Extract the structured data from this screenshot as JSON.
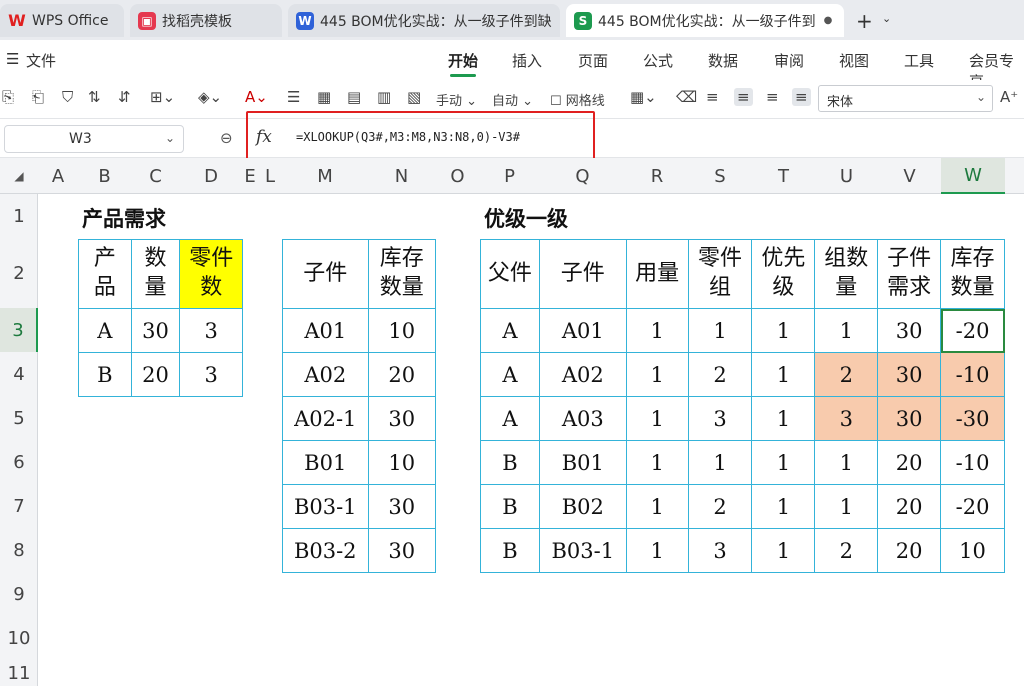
{
  "tabs": [
    {
      "label": "WPS Office",
      "icon": "wps-logo-icon",
      "color": "#e02020"
    },
    {
      "label": "找稻壳模板",
      "icon": "docer-icon",
      "color": "#e5384f"
    },
    {
      "label": "445 BOM优化实战：从一级子件到缺",
      "icon": "W",
      "color": "#2f62d8"
    },
    {
      "label": "445 BOM优化实战：从一级子件到",
      "icon": "S",
      "color": "#1d9a4f"
    }
  ],
  "new_tab_label": "+",
  "file_menu": "文件",
  "menus": [
    "开始",
    "插入",
    "页面",
    "公式",
    "数据",
    "审阅",
    "视图",
    "工具",
    "会员专享"
  ],
  "toolbar": {
    "manual_label": "手动",
    "auto_label": "自动",
    "gridlines_label": "网格线",
    "font_name": "宋体"
  },
  "name_box": "W3",
  "formula": "=XLOOKUP(Q3#,M3:M8,N3:N8,0)-V3#",
  "columns": [
    "A",
    "B",
    "C",
    "D",
    "E",
    "L",
    "M",
    "N",
    "O",
    "P",
    "Q",
    "R",
    "S",
    "T",
    "U",
    "V",
    "W"
  ],
  "rows": [
    "1",
    "2",
    "3",
    "4",
    "5",
    "6",
    "7",
    "8",
    "9",
    "10",
    "11"
  ],
  "table1": {
    "title": "产品需求",
    "headers": [
      "产\n品",
      "数\n量",
      "零件\n数"
    ],
    "rows": [
      [
        "A",
        "30",
        "3"
      ],
      [
        "B",
        "20",
        "3"
      ]
    ]
  },
  "table2": {
    "headers": [
      "子件",
      "库存\n数量"
    ],
    "rows": [
      [
        "A01",
        "10"
      ],
      [
        "A02",
        "20"
      ],
      [
        "A02-1",
        "30"
      ],
      [
        "B01",
        "10"
      ],
      [
        "B03-1",
        "30"
      ],
      [
        "B03-2",
        "30"
      ]
    ]
  },
  "table3": {
    "title": "优级一级",
    "headers": [
      "父件",
      "子件",
      "用量",
      "零件\n组",
      "优先\n级",
      "组数\n量",
      "子件\n需求",
      "库存\n数量"
    ],
    "rows": [
      [
        "A",
        "A01",
        "1",
        "1",
        "1",
        "1",
        "30",
        "-20"
      ],
      [
        "A",
        "A02",
        "1",
        "2",
        "1",
        "2",
        "30",
        "-10"
      ],
      [
        "A",
        "A03",
        "1",
        "3",
        "1",
        "3",
        "30",
        "-30"
      ],
      [
        "B",
        "B01",
        "1",
        "1",
        "1",
        "1",
        "20",
        "-10"
      ],
      [
        "B",
        "B02",
        "1",
        "2",
        "1",
        "1",
        "20",
        "-20"
      ],
      [
        "B",
        "B03-1",
        "1",
        "3",
        "1",
        "2",
        "20",
        "10"
      ]
    ]
  },
  "colors": {
    "accent": "#1d9a4f",
    "table_border": "#34b3d9",
    "highlight_yellow": "#ffff00",
    "highlight_orange": "#f8cbad",
    "formula_box": "#e02020"
  }
}
